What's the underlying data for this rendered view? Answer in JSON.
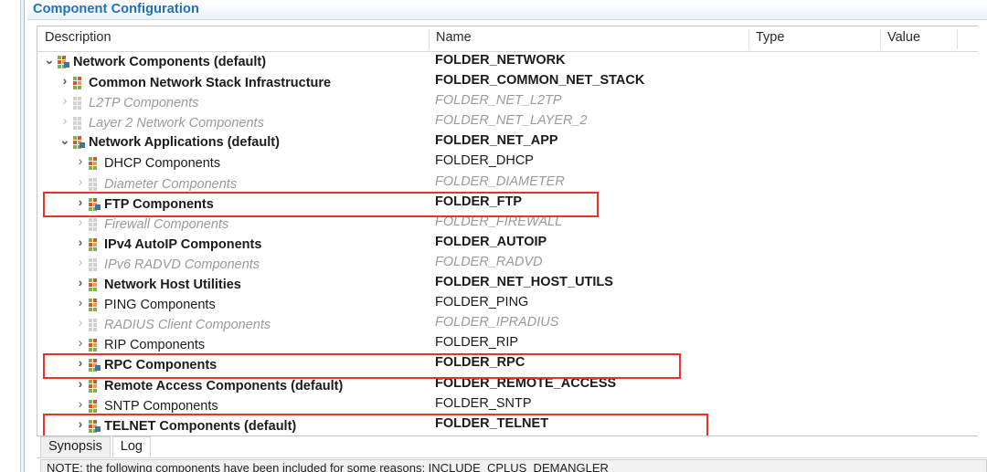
{
  "view": {
    "title": "Component Configuration"
  },
  "columns": [
    {
      "label": "Description"
    },
    {
      "label": "Name"
    },
    {
      "label": "Type"
    },
    {
      "label": "Value"
    }
  ],
  "tree_rows": [
    {
      "indent": 0,
      "twisty": "expanded",
      "icon": "component-folder-multi-icon",
      "description": "Network Components (default)",
      "name": "FOLDER_NETWORK",
      "style": "bold"
    },
    {
      "indent": 1,
      "twisty": "collapsed",
      "icon": "component-folder-icon",
      "description": "Common Network Stack Infrastructure",
      "name": "FOLDER_COMMON_NET_STACK",
      "style": "bold"
    },
    {
      "indent": 1,
      "twisty": "collapsed",
      "icon": "component-folder-disabled-icon",
      "description": "L2TP Components",
      "name": "FOLDER_NET_L2TP",
      "style": "dim"
    },
    {
      "indent": 1,
      "twisty": "collapsed",
      "icon": "component-folder-disabled-icon",
      "description": "Layer 2 Network Components",
      "name": "FOLDER_NET_LAYER_2",
      "style": "dim"
    },
    {
      "indent": 1,
      "twisty": "expanded",
      "icon": "component-folder-multi-icon",
      "description": "Network Applications (default)",
      "name": "FOLDER_NET_APP",
      "style": "bold"
    },
    {
      "indent": 2,
      "twisty": "collapsed",
      "icon": "component-folder-icon",
      "description": "DHCP Components",
      "name": "FOLDER_DHCP",
      "style": "normal"
    },
    {
      "indent": 2,
      "twisty": "collapsed",
      "icon": "component-folder-disabled-icon",
      "description": "Diameter Components",
      "name": "FOLDER_DIAMETER",
      "style": "dim"
    },
    {
      "indent": 2,
      "twisty": "collapsed",
      "icon": "component-folder-multi-icon",
      "description": "FTP Components",
      "name": "FOLDER_FTP",
      "style": "bold"
    },
    {
      "indent": 2,
      "twisty": "collapsed",
      "icon": "component-folder-disabled-icon",
      "description": "Firewall Components",
      "name": "FOLDER_FIREWALL",
      "style": "dim"
    },
    {
      "indent": 2,
      "twisty": "collapsed",
      "icon": "component-folder-icon",
      "description": "IPv4 AutoIP Components",
      "name": "FOLDER_AUTOIP",
      "style": "bold"
    },
    {
      "indent": 2,
      "twisty": "collapsed",
      "icon": "component-folder-disabled-icon",
      "description": "IPv6 RADVD Components",
      "name": "FOLDER_RADVD",
      "style": "dim"
    },
    {
      "indent": 2,
      "twisty": "collapsed",
      "icon": "component-folder-icon",
      "description": "Network Host Utilities",
      "name": "FOLDER_NET_HOST_UTILS",
      "style": "bold"
    },
    {
      "indent": 2,
      "twisty": "collapsed",
      "icon": "component-folder-icon",
      "description": "PING Components",
      "name": "FOLDER_PING",
      "style": "normal"
    },
    {
      "indent": 2,
      "twisty": "collapsed",
      "icon": "component-folder-disabled-icon",
      "description": "RADIUS Client Components",
      "name": "FOLDER_IPRADIUS",
      "style": "dim"
    },
    {
      "indent": 2,
      "twisty": "collapsed",
      "icon": "component-folder-icon",
      "description": "RIP Components",
      "name": "FOLDER_RIP",
      "style": "normal"
    },
    {
      "indent": 2,
      "twisty": "collapsed",
      "icon": "component-folder-multi-icon",
      "description": "RPC Components",
      "name": "FOLDER_RPC",
      "style": "bold"
    },
    {
      "indent": 2,
      "twisty": "collapsed",
      "icon": "component-folder-icon",
      "description": "Remote Access Components (default)",
      "name": "FOLDER_REMOTE_ACCESS",
      "style": "bold"
    },
    {
      "indent": 2,
      "twisty": "collapsed",
      "icon": "component-folder-icon",
      "description": "SNTP Components",
      "name": "FOLDER_SNTP",
      "style": "normal"
    },
    {
      "indent": 2,
      "twisty": "collapsed",
      "icon": "component-folder-multi-icon",
      "description": "TELNET Components (default)",
      "name": "FOLDER_TELNET",
      "style": "bold"
    }
  ],
  "highlights": [
    {
      "target": "FOLDER_FTP",
      "color": "#e8322b"
    },
    {
      "target": "FOLDER_RPC",
      "color": "#e8322b"
    },
    {
      "target": "FOLDER_TELNET",
      "color": "#e8322b"
    }
  ],
  "bottom_tabs": {
    "items": [
      {
        "label": "Synopsis",
        "active": false
      },
      {
        "label": "Log",
        "active": true
      }
    ]
  },
  "log": {
    "text": "NOTE: the following components have been included for  some  reasons:  INCLUDE_CPLUS_DEMANGLER"
  },
  "colors": {
    "view_title": "#1f70c1",
    "highlight": "#e8322b",
    "disabled_text": "#9a9a9a",
    "text": "#1b1b1b"
  }
}
